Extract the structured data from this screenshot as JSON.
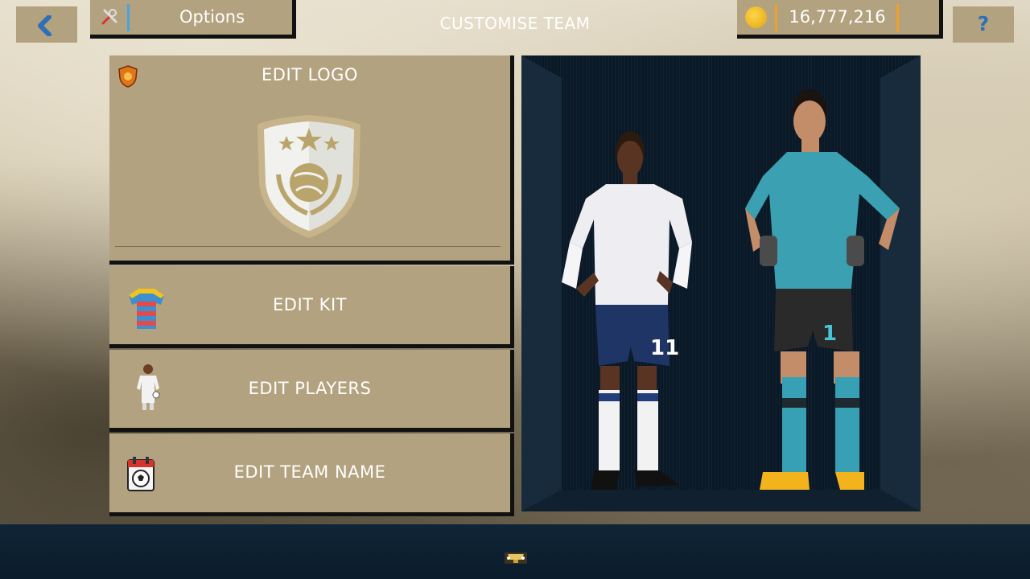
{
  "header": {
    "title": "CUSTOMISE TEAM",
    "options_label": "Options",
    "coins": "16,777,216",
    "help_label": "?"
  },
  "menu": {
    "edit_logo": "EDIT LOGO",
    "edit_kit": "EDIT KIT",
    "edit_players": "EDIT PLAYERS",
    "edit_team_name": "EDIT TEAM NAME"
  },
  "preview": {
    "outfield_player_number": "11",
    "goalkeeper_number": "1"
  },
  "icons": [
    "back-arrow-icon",
    "tools-icon",
    "coin-icon",
    "help-icon",
    "shield-icon",
    "team-crest",
    "kit-shirt-icon",
    "player-icon",
    "calendar-ball-icon",
    "trophy-icon"
  ],
  "colors": {
    "tile": "#b3a27f",
    "accent_blue": "#4aa2de",
    "accent_orange": "#f0a12a",
    "preview_bg": "#0c1a28"
  }
}
